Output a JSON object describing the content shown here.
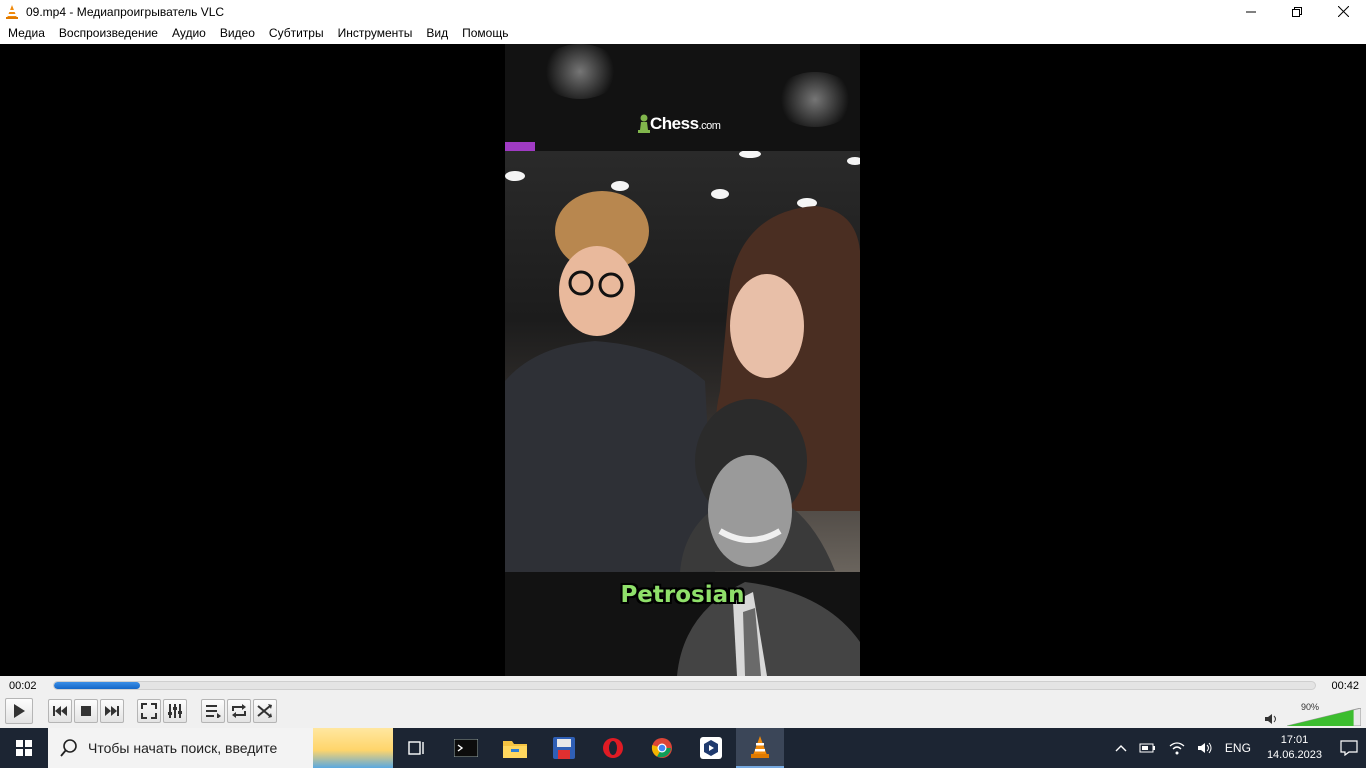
{
  "window": {
    "title": "09.mp4 - Медиапроигрыватель VLC",
    "app_icon": "vlc-cone-icon",
    "controls": [
      "minimize-icon",
      "restore-icon",
      "close-icon"
    ]
  },
  "menu": {
    "items": [
      "Медиа",
      "Воспроизведение",
      "Аудио",
      "Видео",
      "Субтитры",
      "Инструменты",
      "Вид",
      "Помощь"
    ]
  },
  "video": {
    "logo_text": "Chess",
    "logo_suffix": ".com",
    "caption": "Petrosian",
    "accent_color": "#a03bc4",
    "caption_color": "#8fe06a"
  },
  "player": {
    "time_elapsed": "00:02",
    "time_total": "00:42",
    "progress_fraction": 0.068,
    "accent_color": "#1467c8",
    "buttons": [
      "play-button",
      "prev-button",
      "stop-button",
      "next-button",
      "fullscreen-button",
      "extended-settings-button",
      "playlist-button",
      "loop-button",
      "shuffle-button"
    ],
    "volume_label": "90%",
    "volume_fraction": 0.9
  },
  "taskbar": {
    "search_placeholder": "Чтобы начать поиск, введите",
    "apps": [
      "task-view-icon",
      "terminal-icon",
      "file-explorer-icon",
      "save-disk-icon",
      "opera-icon",
      "chrome-icon",
      "app-hexagon-icon",
      "vlc-taskbar-icon"
    ],
    "language": "ENG",
    "time": "17:01",
    "date": "14.06.2023"
  }
}
